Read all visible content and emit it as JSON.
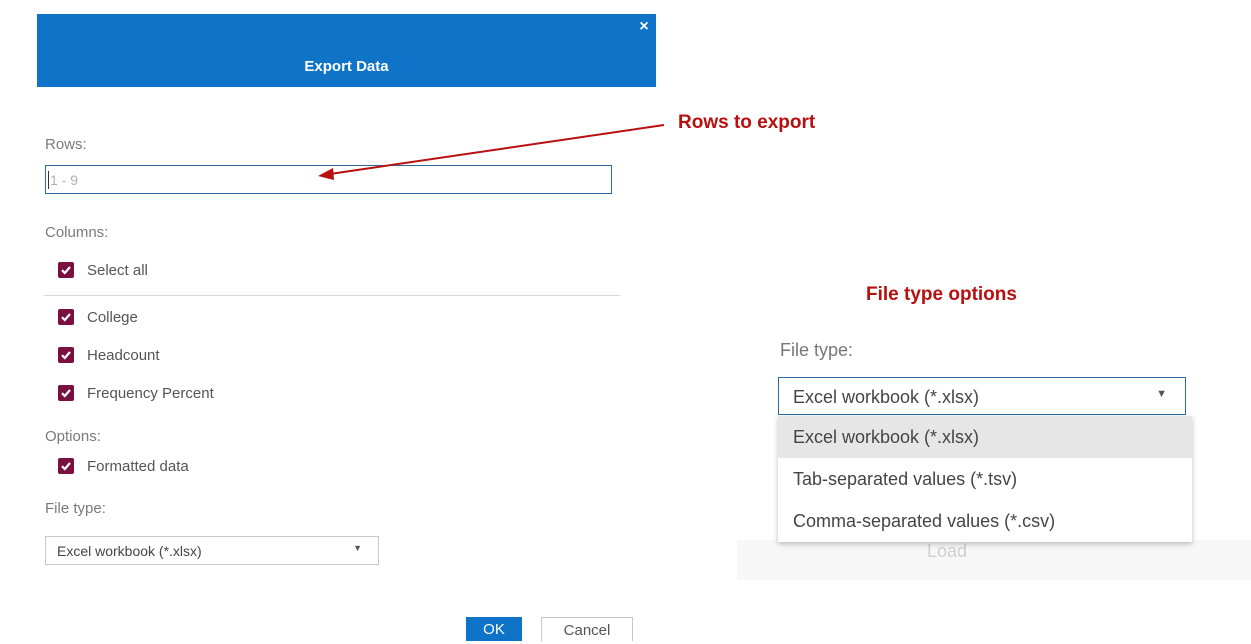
{
  "dialog": {
    "title": "Export Data",
    "close_glyph": "×",
    "rows_label": "Rows:",
    "rows_placeholder": "1 - 9",
    "columns_label": "Columns:",
    "select_all_label": "Select all",
    "columns": [
      {
        "label": "College",
        "checked": true
      },
      {
        "label": "Headcount",
        "checked": true
      },
      {
        "label": "Frequency Percent",
        "checked": true
      }
    ],
    "options_label": "Options:",
    "formatted_label": "Formatted data",
    "file_type_label": "File type:",
    "file_type_value": "Excel workbook (*.xlsx)",
    "ok_label": "OK",
    "cancel_label": "Cancel"
  },
  "annotations": {
    "rows_to_export": "Rows to export",
    "file_type_options": "File type options"
  },
  "inset": {
    "file_type_label": "File type:",
    "selected": "Excel workbook (*.xlsx)",
    "options": [
      "Excel workbook (*.xlsx)",
      "Tab-separated values (*.tsv)",
      "Comma-separated values (*.csv)"
    ],
    "obscured_text": "Load"
  },
  "colors": {
    "header_blue": "#0f74c7",
    "checkbox_maroon": "#7a1040",
    "annotation_red": "#b80f0f"
  },
  "icons": {
    "close": "close-icon",
    "check": "checkmark-icon",
    "dropdown": "chevron-down-icon"
  }
}
